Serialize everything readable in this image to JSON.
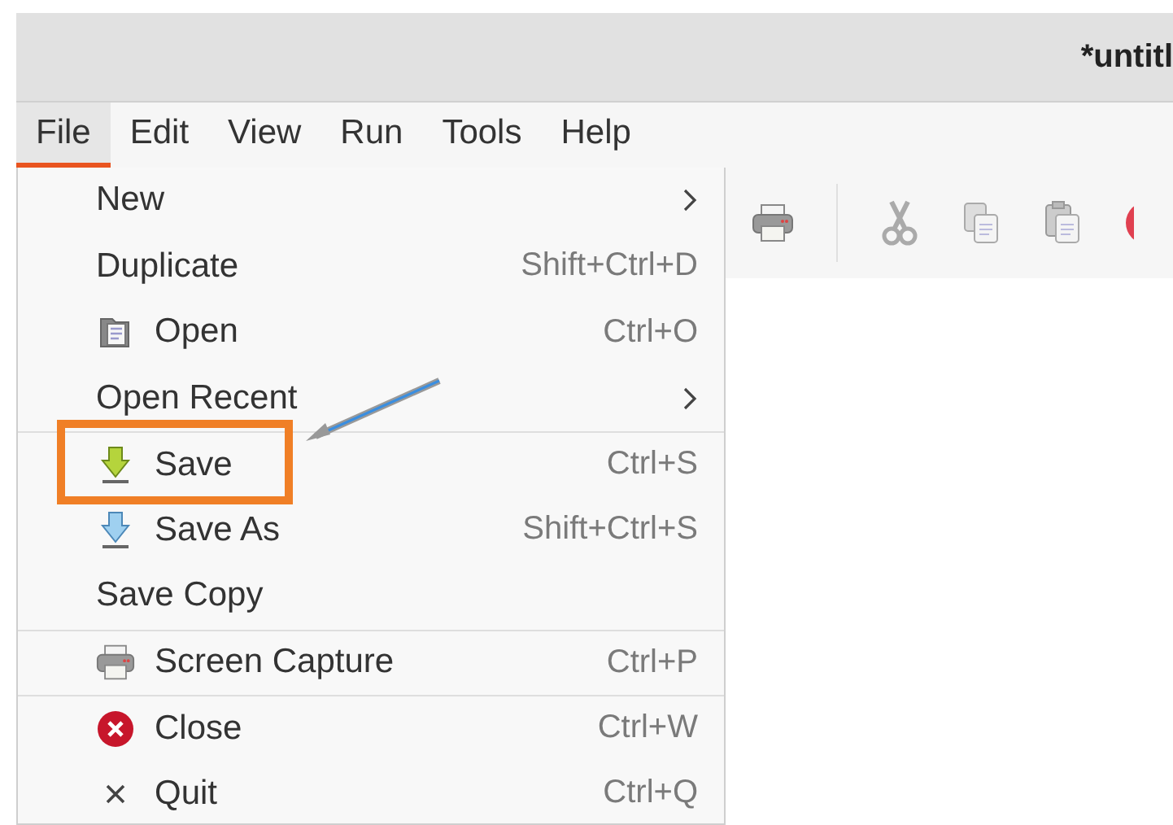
{
  "window": {
    "title": "*untitl"
  },
  "menu_bar": [
    {
      "label": "File",
      "selected": true
    },
    {
      "label": "Edit",
      "selected": false
    },
    {
      "label": "View",
      "selected": false
    },
    {
      "label": "Run",
      "selected": false
    },
    {
      "label": "Tools",
      "selected": false
    },
    {
      "label": "Help",
      "selected": false
    }
  ],
  "file_menu": [
    {
      "label": "New",
      "kind": "submenu",
      "separator_before": false
    },
    {
      "label": "Duplicate",
      "kind": "plain",
      "shortcut": "Shift+Ctrl+D",
      "separator_before": false
    },
    {
      "label": "Open",
      "kind": "open",
      "shortcut": "Ctrl+O",
      "separator_before": false
    },
    {
      "label": "Open Recent",
      "kind": "submenu",
      "separator_before": false
    },
    {
      "label": "Save",
      "kind": "save",
      "shortcut": "Ctrl+S",
      "separator_before": true
    },
    {
      "label": "Save As",
      "kind": "save-as",
      "shortcut": "Shift+Ctrl+S",
      "separator_before": false
    },
    {
      "label": "Save Copy",
      "kind": "plain",
      "separator_before": false
    },
    {
      "label": "Screen Capture",
      "kind": "print",
      "shortcut": "Ctrl+P",
      "separator_before": true
    },
    {
      "label": "Close",
      "kind": "close",
      "shortcut": "Ctrl+W",
      "separator_before": true
    },
    {
      "label": "Quit",
      "kind": "quit",
      "shortcut": "Ctrl+Q",
      "separator_before": false
    }
  ]
}
